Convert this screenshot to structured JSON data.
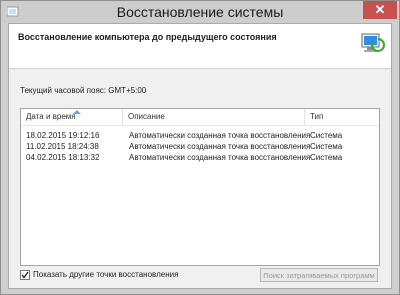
{
  "window": {
    "title": "Восстановление системы",
    "close_label": "✕"
  },
  "header": {
    "text": "Восстановление компьютера до предыдущего состояния"
  },
  "timezone": "Текущий часовой пояс: GMT+5:00",
  "table": {
    "columns": [
      "Дата и время",
      "Описание",
      "Тип"
    ],
    "rows": [
      [
        "18.02.2015 19:12:16",
        "Автоматически созданная точка восстановления",
        "Система"
      ],
      [
        "11.02.2015 18:24:38",
        "Автоматически созданная точка восстановления",
        "Система"
      ],
      [
        "04.02.2015 18:13:32",
        "Автоматически созданная точка восстановления",
        "Система"
      ]
    ]
  },
  "show_more": {
    "label": "Показать другие точки восстановления",
    "checked": true
  },
  "search_button": "Поиск затрагиваемых программ",
  "colors": {
    "close": "#c75050",
    "titlebar": "#cdcdcd"
  }
}
